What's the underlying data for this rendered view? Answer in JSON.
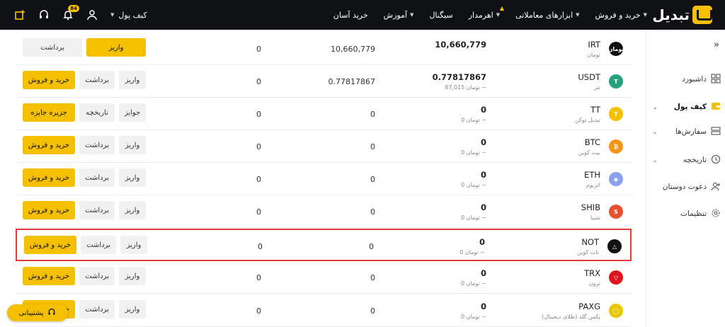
{
  "brand": {
    "logo_text": "تبدیل"
  },
  "nav": [
    {
      "label": "خرید و فروش",
      "caret": true
    },
    {
      "label": "ابزارهای معاملاتی",
      "caret": true
    },
    {
      "label": "اهرمدار",
      "caret": true,
      "flame": true
    },
    {
      "label": "سیگنال"
    },
    {
      "label": "آموزش",
      "caret": true
    },
    {
      "label": "خرید آسان"
    }
  ],
  "top_left": {
    "wallet_label": "کیف پول",
    "notification_count": "84"
  },
  "sidebar": [
    {
      "label": "داشبورد",
      "icon": "dashboard-icon"
    },
    {
      "label": "کیف پول",
      "icon": "wallet-icon",
      "active": true
    },
    {
      "label": "سفارش‌ها",
      "icon": "orders-icon"
    },
    {
      "label": "تاریخچه",
      "icon": "history-icon"
    },
    {
      "label": "دعوت دوستان",
      "icon": "invite-icon"
    },
    {
      "label": "تنظیمات",
      "icon": "settings-icon"
    }
  ],
  "rows": [
    {
      "symbol": "IRT",
      "name": "تومان",
      "total": "10,660,779",
      "toman": "",
      "available": "10,660,779",
      "blocked": "0",
      "icon_color": "#111111",
      "icon_text": "تومان",
      "buttons": [
        {
          "label": "واریز",
          "style": "yellow"
        },
        {
          "label": "برداشت",
          "style": "gray"
        }
      ]
    },
    {
      "symbol": "USDT",
      "name": "تتر",
      "total": "0.77817867",
      "toman": "تومان 87,015 ~",
      "available": "0.77817867",
      "blocked": "0",
      "icon_color": "#26a17b",
      "icon_text": "T",
      "buttons": [
        {
          "label": "واریز",
          "style": "gray"
        },
        {
          "label": "برداشت",
          "style": "gray"
        },
        {
          "label": "خرید و فروش",
          "style": "yellow"
        }
      ]
    },
    {
      "symbol": "TT",
      "name": "تبدیل توکن",
      "total": "0",
      "toman": "تومان 0 ~",
      "available": "0",
      "blocked": "0",
      "icon_color": "#f5c000",
      "icon_text": "T",
      "buttons": [
        {
          "label": "جوایز",
          "style": "gray"
        },
        {
          "label": "تاریخچه",
          "style": "gray"
        },
        {
          "label": "جزیره جایزه",
          "style": "yellow"
        }
      ]
    },
    {
      "symbol": "BTC",
      "name": "بیت کوین",
      "total": "0",
      "toman": "تومان 0 ~",
      "available": "0",
      "blocked": "0",
      "icon_color": "#f7931a",
      "icon_text": "₿",
      "buttons": [
        {
          "label": "واریز",
          "style": "gray"
        },
        {
          "label": "برداشت",
          "style": "gray"
        },
        {
          "label": "خرید و فروش",
          "style": "yellow"
        }
      ]
    },
    {
      "symbol": "ETH",
      "name": "اتریوم",
      "total": "0",
      "toman": "تومان 0 ~",
      "available": "0",
      "blocked": "0",
      "icon_color": "#8aa1f0",
      "icon_text": "◆",
      "buttons": [
        {
          "label": "واریز",
          "style": "gray"
        },
        {
          "label": "برداشت",
          "style": "gray"
        },
        {
          "label": "خرید و فروش",
          "style": "yellow"
        }
      ]
    },
    {
      "symbol": "SHIB",
      "name": "شیبا",
      "total": "0",
      "toman": "تومان 0 ~",
      "available": "0",
      "blocked": "0",
      "icon_color": "#e8502f",
      "icon_text": "S",
      "buttons": [
        {
          "label": "واریز",
          "style": "gray"
        },
        {
          "label": "برداشت",
          "style": "gray"
        },
        {
          "label": "خرید و فروش",
          "style": "yellow"
        }
      ]
    },
    {
      "symbol": "NOT",
      "name": "نات کوین",
      "total": "0",
      "toman": "تومان 0 ~",
      "available": "0",
      "blocked": "0",
      "icon_color": "#111111",
      "icon_text": "△",
      "highlight": true,
      "buttons": [
        {
          "label": "واریز",
          "style": "gray"
        },
        {
          "label": "برداشت",
          "style": "gray"
        },
        {
          "label": "خرید و فروش",
          "style": "yellow"
        }
      ]
    },
    {
      "symbol": "TRX",
      "name": "ترون",
      "total": "0",
      "toman": "تومان 0 ~",
      "available": "0",
      "blocked": "0",
      "icon_color": "#e0141e",
      "icon_text": "▽",
      "buttons": [
        {
          "label": "واریز",
          "style": "gray"
        },
        {
          "label": "برداشت",
          "style": "gray"
        },
        {
          "label": "خرید و فروش",
          "style": "yellow"
        }
      ]
    },
    {
      "symbol": "PAXG",
      "name": "پکس گلد (طلای دیجیتال)",
      "total": "0",
      "toman": "تومان 0 ~",
      "available": "0",
      "blocked": "0",
      "icon_color": "#e8c600",
      "icon_text": "◯",
      "buttons": [
        {
          "label": "واریز",
          "style": "gray"
        },
        {
          "label": "برداشت",
          "style": "gray"
        },
        {
          "label": "خرید و فروش",
          "style": "yellow"
        }
      ]
    }
  ],
  "support": {
    "label": "پشتیبانی"
  },
  "colors": {
    "accent": "#f5c000",
    "highlight": "#e23b3b",
    "topbar": "#0f1115"
  }
}
